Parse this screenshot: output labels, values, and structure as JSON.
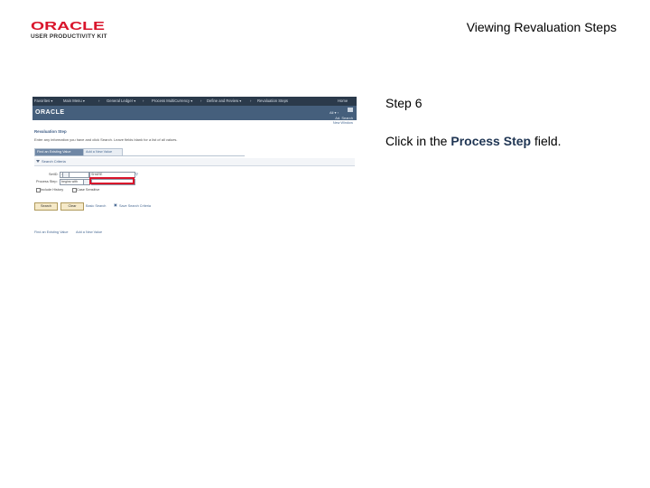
{
  "logo": {
    "wordmark": "ORACLE",
    "subtitle": "USER PRODUCTIVITY KIT"
  },
  "header": {
    "title": "Viewing Revaluation Steps"
  },
  "step": {
    "number": "Step 6",
    "instruction_pre": "Click in the ",
    "instruction_bold": "Process Step",
    "instruction_post": " field."
  },
  "screenshot": {
    "nav_items": [
      "Favorites ▾",
      "Main Menu ▾",
      "›",
      "General Ledger ▾",
      "›",
      "Process MultiCurrency ▾",
      "›",
      "Define and Review ▾",
      "›",
      "Revaluation Steps"
    ],
    "home": "Home",
    "oracle": "ORACLE",
    "header_right": "All ▾   ›",
    "advanced": "Ad. Search",
    "new_window": "New Window",
    "page_title": "Revaluation Step",
    "instruction": "Enter any information you have and click Search. Leave fields blank for a list of all values.",
    "tabs": {
      "active": "Find an Existing Value",
      "inactive": "Add a New Value"
    },
    "section": "Search Criteria",
    "setid_label": "SetID:",
    "setid_op": "=",
    "setid_value": "SHARE",
    "step_label": "Process Step:",
    "step_op": "begins with",
    "case_sensitive": "Case Sensitive",
    "include_history": "Include History",
    "search_btn": "Search",
    "clear_btn": "Clear",
    "basic_search": "Basic Search",
    "save_criteria": "Save Search Criteria",
    "find_existing": "Find an Existing Value",
    "add_new": "Add a New Value"
  }
}
